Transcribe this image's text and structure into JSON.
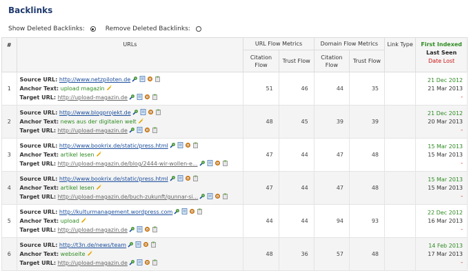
{
  "title": "Backlinks",
  "options": {
    "show_deleted_label": "Show Deleted Backlinks:",
    "remove_deleted_label": "Remove Deleted Backlinks:",
    "selected": "show"
  },
  "table": {
    "headers": {
      "num": "#",
      "urls": "URLs",
      "url_flow": "URL Flow Metrics",
      "domain_flow": "Domain Flow Metrics",
      "link_type": "Link Type",
      "citation_flow": "Citation Flow",
      "trust_flow": "Trust Flow",
      "first_indexed": "First Indexed",
      "last_seen": "Last Seen",
      "date_lost": "Date Lost"
    },
    "labels": {
      "source": "Source URL:",
      "anchor": "Anchor Text:",
      "target": "Target URL:"
    },
    "rows": [
      {
        "num": "1",
        "source": "http://www.netzpiloten.de",
        "anchor": "upload magazin",
        "target": "http://upload-magazin.de",
        "url_cf": "51",
        "url_tf": "46",
        "dom_cf": "44",
        "dom_tf": "35",
        "link_type": "",
        "first_indexed": "21 Dec 2012",
        "last_seen": "21 Mar 2013",
        "date_lost": "-"
      },
      {
        "num": "2",
        "source": "http://www.blogprojekt.de",
        "anchor": "news aus der digitalen welt",
        "target": "http://upload-magazin.de",
        "url_cf": "48",
        "url_tf": "45",
        "dom_cf": "39",
        "dom_tf": "39",
        "link_type": "",
        "first_indexed": "21 Dec 2012",
        "last_seen": "20 Mar 2013",
        "date_lost": "-"
      },
      {
        "num": "3",
        "source": "http://www.bookrix.de/static/press.html",
        "anchor": "artikel lesen",
        "target": "http://upload-magazin.de/blog/2444-wir-wollen-e...",
        "url_cf": "47",
        "url_tf": "44",
        "dom_cf": "47",
        "dom_tf": "48",
        "link_type": "",
        "first_indexed": "15 Mar 2013",
        "last_seen": "15 Mar 2013",
        "date_lost": "-"
      },
      {
        "num": "4",
        "source": "http://www.bookrix.de/static/press.html",
        "anchor": "artikel lesen",
        "target": "http://upload-magazin.de/buch-zukunft/gunnar-si...",
        "url_cf": "47",
        "url_tf": "44",
        "dom_cf": "47",
        "dom_tf": "48",
        "link_type": "",
        "first_indexed": "15 Mar 2013",
        "last_seen": "15 Mar 2013",
        "date_lost": "-"
      },
      {
        "num": "5",
        "source": "http://kulturmanagement.wordpress.com",
        "anchor": "upload",
        "target": "http://upload-magazin.de",
        "url_cf": "44",
        "url_tf": "44",
        "dom_cf": "94",
        "dom_tf": "93",
        "link_type": "",
        "first_indexed": "22 Dec 2012",
        "last_seen": "16 Mar 2013",
        "date_lost": "-"
      },
      {
        "num": "6",
        "source": "http://t3n.de/news/team",
        "anchor": "webseite",
        "target": "http://upload-magazin.de",
        "url_cf": "48",
        "url_tf": "36",
        "dom_cf": "57",
        "dom_tf": "48",
        "link_type": "",
        "first_indexed": "14 Feb 2013",
        "last_seen": "17 Mar 2013",
        "date_lost": "-"
      }
    ]
  },
  "icons": [
    "site-explorer-icon",
    "report-icon",
    "settings-icon",
    "bookmark-icon",
    "edit-anchor-icon"
  ],
  "colors": {
    "title": "#1f3a6e",
    "link": "#1a4d9c",
    "anchor": "#2e8b22",
    "date_lost": "#cc1111"
  }
}
